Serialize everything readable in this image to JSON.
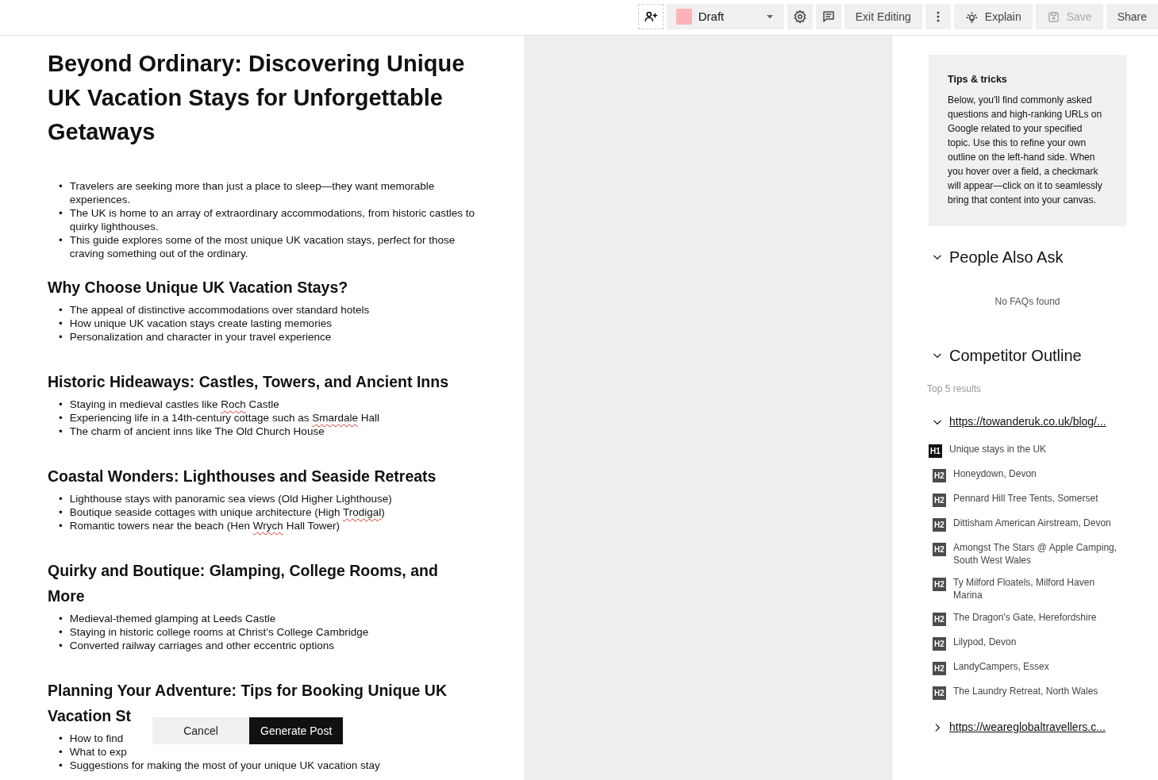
{
  "toolbar": {
    "status": {
      "label": "Draft",
      "color": "#ffb3b8"
    },
    "buttons": [
      {
        "kind": "exit",
        "label": "Exit Editing",
        "disabled": false
      },
      {
        "kind": "explain",
        "label": "Explain",
        "disabled": false
      },
      {
        "kind": "save",
        "label": "Save",
        "disabled": true
      },
      {
        "kind": "share",
        "label": "Share",
        "disabled": false
      }
    ]
  },
  "document": {
    "title": "Beyond Ordinary: Discovering Unique UK Vacation Stays for Unforgettable Getaways",
    "sections": [
      {
        "bullets": [
          {
            "marker": "•",
            "parts": [
              {
                "text": "Travelers are seeking more than just a place to sleep—they want memorable experiences.",
                "misspelled": false
              }
            ]
          },
          {
            "marker": "•",
            "parts": [
              {
                "text": "The UK is home to an array of extraordinary accommodations, from historic castles to quirky lighthouses.",
                "misspelled": false
              }
            ]
          },
          {
            "marker": "•",
            "parts": [
              {
                "text": "This guide explores some of the most unique UK vacation stays, perfect for those craving something out of the ordinary.",
                "misspelled": false
              }
            ]
          }
        ]
      },
      {
        "heading": "Why Choose Unique UK Vacation Stays?",
        "bullets": [
          {
            "marker": "•",
            "parts": [
              {
                "text": "The appeal of distinctive accommodations over standard hotels",
                "misspelled": false
              }
            ]
          },
          {
            "marker": "•",
            "parts": [
              {
                "text": "How unique UK vacation stays create lasting memories",
                "misspelled": false
              }
            ]
          },
          {
            "marker": "•",
            "parts": [
              {
                "text": "Personalization and character in your travel experience",
                "misspelled": false
              }
            ]
          }
        ]
      },
      {
        "heading": "Historic Hideaways: Castles, Towers, and Ancient Inns",
        "bullets": [
          {
            "marker": "•",
            "parts": [
              {
                "text": "Staying in medieval castles like ",
                "misspelled": false
              },
              {
                "text": "Roch",
                "misspelled": true
              },
              {
                "text": " Castle",
                "misspelled": false
              }
            ]
          },
          {
            "marker": "•",
            "parts": [
              {
                "text": "Experiencing life in a 14th-century cottage such as ",
                "misspelled": false
              },
              {
                "text": "Smardale",
                "misspelled": true
              },
              {
                "text": " Hall",
                "misspelled": false
              }
            ]
          },
          {
            "marker": "•",
            "parts": [
              {
                "text": "The charm of ancient inns like The Old Church House",
                "misspelled": false
              }
            ]
          }
        ]
      },
      {
        "heading": "Coastal Wonders: Lighthouses and Seaside Retreats",
        "bullets": [
          {
            "marker": "•",
            "parts": [
              {
                "text": "Lighthouse stays with panoramic sea views (Old Higher Lighthouse)",
                "misspelled": false
              }
            ]
          },
          {
            "marker": "•",
            "parts": [
              {
                "text": "Boutique seaside cottages with unique architecture (High ",
                "misspelled": false
              },
              {
                "text": "Trodigal",
                "misspelled": true
              },
              {
                "text": ")",
                "misspelled": false
              }
            ]
          },
          {
            "marker": "•",
            "parts": [
              {
                "text": "Romantic towers near the beach (Hen ",
                "misspelled": false
              },
              {
                "text": "Wrych",
                "misspelled": true
              },
              {
                "text": " Hall Tower)",
                "misspelled": false
              }
            ]
          }
        ]
      },
      {
        "heading": "Quirky and Boutique: Glamping, College Rooms, and More",
        "bullets": [
          {
            "marker": "•",
            "parts": [
              {
                "text": "Medieval-themed glamping at Leeds Castle",
                "misspelled": false
              }
            ]
          },
          {
            "marker": "•",
            "parts": [
              {
                "text": "Staying in historic college rooms at Christ’s College Cambridge",
                "misspelled": false
              }
            ]
          },
          {
            "marker": "•",
            "parts": [
              {
                "text": "Converted railway carriages and other eccentric options",
                "misspelled": false
              }
            ]
          }
        ]
      },
      {
        "heading": "Planning Your Adventure: Tips for Booking Unique UK Vacation St",
        "bullets": [
          {
            "marker": "•",
            "parts": [
              {
                "text": "How to find",
                "misspelled": false
              }
            ]
          },
          {
            "marker": "•",
            "parts": [
              {
                "text": "What to exp",
                "misspelled": false
              }
            ]
          },
          {
            "marker": "•",
            "parts": [
              {
                "text": "Suggestions for making the most of your unique UK vacation stay",
                "misspelled": false
              }
            ]
          }
        ]
      }
    ]
  },
  "popup": {
    "cancel": "Cancel",
    "generate": "Generate Post"
  },
  "sidebar": {
    "tips": {
      "title": "Tips & tricks",
      "body": "Below, you'll find commonly asked questions and high-ranking URLs on Google related to your specified topic. Use this to refine your own outline on the left-hand side. When you hover over a field, a checkmark will appear—click on it to seamlessly bring that content into your canvas."
    },
    "people_also_ask": {
      "title": "People Also Ask",
      "expanded": true,
      "empty": "No FAQs found"
    },
    "competitor_outline": {
      "title": "Competitor Outline",
      "expanded": true,
      "subtitle": "Top 5 results",
      "results": [
        {
          "url": "https://towanderuk.co.uk/blog/...",
          "expanded": true,
          "headings": [
            {
              "kind": "h1",
              "tag": "H1",
              "text": "Unique stays in the UK"
            },
            {
              "kind": "h2",
              "tag": "H2",
              "text": "Honeydown, Devon"
            },
            {
              "kind": "h2",
              "tag": "H2",
              "text": "Pennard Hill Tree Tents, Somerset"
            },
            {
              "kind": "h2",
              "tag": "H2",
              "text": "Dittisham American Airstream, Devon"
            },
            {
              "kind": "h2",
              "tag": "H2",
              "text": "Amongst The Stars @ Apple Camping, South West Wales"
            },
            {
              "kind": "h2",
              "tag": "H2",
              "text": "Ty Milford Floatels, Milford Haven Marina"
            },
            {
              "kind": "h2",
              "tag": "H2",
              "text": "The Dragon's Gate, Herefordshire"
            },
            {
              "kind": "h2",
              "tag": "H2",
              "text": "Lilypod, Devon"
            },
            {
              "kind": "h2",
              "tag": "H2",
              "text": "LandyCampers, Essex"
            },
            {
              "kind": "h2",
              "tag": "H2",
              "text": "The Laundry Retreat, North Wales"
            }
          ]
        },
        {
          "url": "https://weareglobaltravellers.c...",
          "expanded": false
        }
      ]
    }
  }
}
